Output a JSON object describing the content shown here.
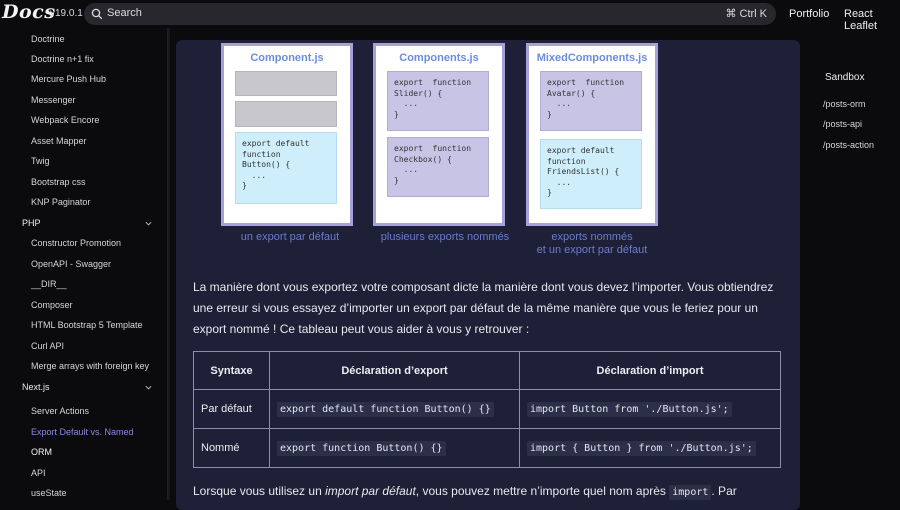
{
  "header": {
    "logo": "Docs",
    "version": "v19.0.1",
    "search_placeholder": "Search",
    "search_shortcut": "⌘ Ctrl K",
    "nav": [
      "Portfolio",
      "React Leaflet"
    ]
  },
  "sidebar": {
    "items": [
      {
        "label": "Doctrine",
        "kind": "item"
      },
      {
        "label": "Doctrine n+1 fix",
        "kind": "item"
      },
      {
        "label": "Mercure Push Hub",
        "kind": "item"
      },
      {
        "label": "Messenger",
        "kind": "item"
      },
      {
        "label": "Webpack Encore",
        "kind": "item"
      },
      {
        "label": "Asset Mapper",
        "kind": "item"
      },
      {
        "label": "Twig",
        "kind": "item"
      },
      {
        "label": "Bootstrap css",
        "kind": "item"
      },
      {
        "label": "KNP Paginator",
        "kind": "item"
      },
      {
        "label": "PHP",
        "kind": "section"
      },
      {
        "label": "Constructor Promotion",
        "kind": "item"
      },
      {
        "label": "OpenAPI - Swagger",
        "kind": "item"
      },
      {
        "label": "__DIR__",
        "kind": "item"
      },
      {
        "label": "Composer",
        "kind": "item"
      },
      {
        "label": "HTML Bootstrap 5 Template",
        "kind": "item"
      },
      {
        "label": "Curl API",
        "kind": "item"
      },
      {
        "label": "Merge arrays with foreign key",
        "kind": "item"
      },
      {
        "label": "Next.js",
        "kind": "section"
      },
      {
        "label": "Server Actions",
        "kind": "item"
      },
      {
        "label": "Export Default vs. Named",
        "kind": "active"
      },
      {
        "label": "ORM",
        "kind": "strong"
      },
      {
        "label": "API",
        "kind": "item"
      },
      {
        "label": "useState",
        "kind": "item"
      }
    ]
  },
  "diagram": {
    "panels": [
      {
        "title": "Component.js",
        "caption": "un export par défaut"
      },
      {
        "title": "Components.js",
        "caption": "plusieurs exports nommés"
      },
      {
        "title": "MixedComponents.js",
        "caption_line1": "exports nommés",
        "caption_line2": "et un export par défaut"
      }
    ],
    "code": {
      "p1_default": "export default\nfunction\nButton() {\n  ...\n}",
      "p2_slider": "export  function\nSlider() {\n  ...\n}",
      "p2_checkbox": "export  function\nCheckbox() {\n  ...\n}",
      "p3_avatar": "export  function\nAvatar() {\n  ...\n}",
      "p3_friends": "export default\nfunction\nFriendsList() {\n  ...\n}"
    }
  },
  "content": {
    "paragraph": "La manière dont vous exportez votre composant dicte la manière dont vous devez l’importer. Vous obtiendrez une erreur si vous essayez d’importer un export par défaut de la même manière que vous le feriez pour un export nommé ! Ce tableau peut vous aider à vous y retrouver :",
    "table": {
      "headers": [
        "Syntaxe",
        "Déclaration d’export",
        "Déclaration d’import"
      ],
      "rows": [
        [
          "Par défaut",
          "export default function Button() {}",
          "import Button from './Button.js';"
        ],
        [
          "Nommé",
          "export function Button() {}",
          "import { Button } from './Button.js';"
        ]
      ]
    },
    "bottom_before": "Lorsque vous utilisez un ",
    "bottom_em": "import par défaut",
    "bottom_middle": ", vous pouvez mettre n’importe quel nom après ",
    "bottom_code": "import",
    "bottom_after": ". Par"
  },
  "toc": {
    "title": "Sandbox",
    "items": [
      "/posts-orm",
      "/posts-api",
      "/posts-action"
    ]
  }
}
